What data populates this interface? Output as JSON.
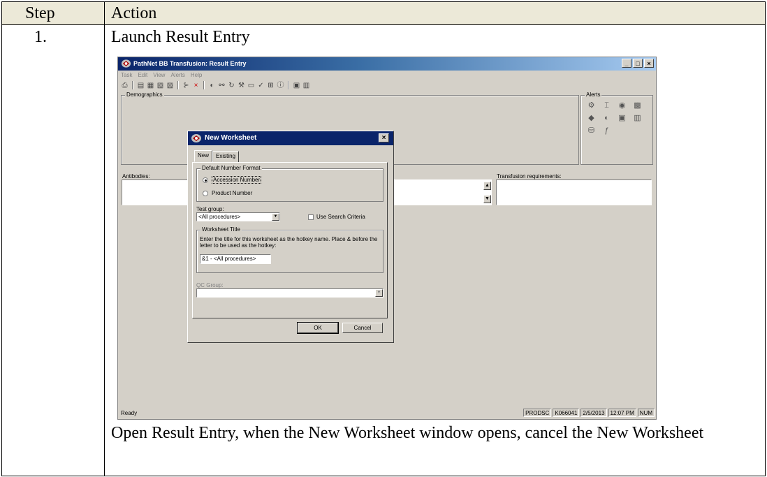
{
  "table": {
    "col_step": "Step",
    "col_action": "Action",
    "step_number": "1.",
    "step_title": "Launch Result Entry",
    "instruction": "Open Result Entry, when the New Worksheet window opens, cancel the New Worksheet"
  },
  "app": {
    "title": "PathNet BB Transfusion: Result Entry",
    "menu": [
      "Task",
      "Edit",
      "View",
      "Alerts",
      "Help"
    ],
    "demographics_label": "Demographics",
    "alerts_label": "Alerts",
    "antibodies_label": "Antibodies:",
    "transfusion_label": "Transfusion requirements:",
    "status": {
      "ready": "Ready",
      "server": "PRODSC",
      "user": "K066041",
      "date": "2/5/2013",
      "time": "12:07 PM",
      "num": "NUM"
    }
  },
  "dialog": {
    "title": "New Worksheet",
    "tabs": [
      "New",
      "Existing"
    ],
    "default_number_format": "Default Number Format",
    "radio_accession": "Accession Number",
    "radio_product": "Product Number",
    "test_group_label": "Test group:",
    "test_group_value": "<All procedures>",
    "use_search_criteria": "Use Search Criteria",
    "worksheet_title_label": "Worksheet Title",
    "worksheet_title_help": "Enter the title for this worksheet as the hotkey name.  Place & before the letter to be used as the hotkey:",
    "worksheet_title_value": "&1 - <All procedures>",
    "qc_group_label": "QC Group:",
    "ok": "OK",
    "cancel": "Cancel"
  }
}
